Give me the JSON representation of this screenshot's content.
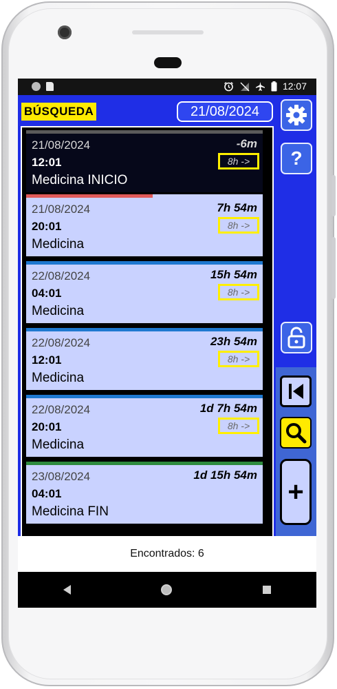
{
  "statusbar": {
    "time": "12:07"
  },
  "header": {
    "title": "BÚSQUEDA",
    "date": "21/08/2024"
  },
  "icons": {
    "settings": "gear-icon",
    "help": "question-icon",
    "lock": "lock-icon",
    "first": "skip-first-icon",
    "search": "search-icon",
    "add": "plus-icon"
  },
  "colors": {
    "app_bg": "#1f2ee6",
    "title_bg": "#ffea00",
    "card_bg": "#c9d2ff",
    "active_bg": "#06081a",
    "strip_red": "#e05a5a",
    "strip_blue": "#1e78d0",
    "strip_green": "#2e8b3e",
    "interval_border": "#ffef00"
  },
  "buttons": {
    "help_label": "?",
    "add_label": "+"
  },
  "entries": [
    {
      "date": "21/08/2024",
      "time": "12:01",
      "name": "Medicina INICIO",
      "duration": "-6m",
      "interval": "8h ->"
    },
    {
      "date": "21/08/2024",
      "time": "20:01",
      "name": "Medicina",
      "duration": "7h 54m",
      "interval": "8h ->"
    },
    {
      "date": "22/08/2024",
      "time": "04:01",
      "name": "Medicina",
      "duration": "15h 54m",
      "interval": "8h ->"
    },
    {
      "date": "22/08/2024",
      "time": "12:01",
      "name": "Medicina",
      "duration": "23h 54m",
      "interval": "8h ->"
    },
    {
      "date": "22/08/2024",
      "time": "20:01",
      "name": "Medicina",
      "duration": "1d 7h 54m",
      "interval": "8h ->"
    },
    {
      "date": "23/08/2024",
      "time": "04:01",
      "name": "Medicina FIN",
      "duration": "1d 15h 54m"
    }
  ],
  "footer": {
    "found": "Encontrados: 6"
  }
}
